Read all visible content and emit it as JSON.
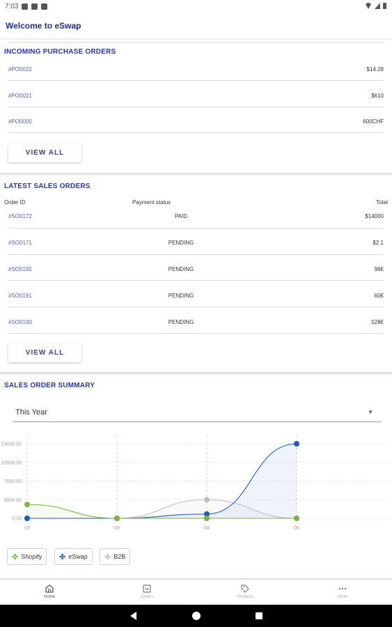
{
  "status_bar": {
    "time": "7:03"
  },
  "app": {
    "title": "Welcome to eSwap"
  },
  "incoming_purchase_orders": {
    "title": "INCOMING PURCHASE ORDERS",
    "rows": [
      {
        "id": "#PO0022",
        "amount": "$14.28"
      },
      {
        "id": "#PO0021",
        "amount": "$610"
      },
      {
        "id": "#PO0005",
        "amount": "600CHF"
      }
    ],
    "view_all": "VIEW ALL"
  },
  "latest_sales_orders": {
    "title": "LATEST SALES ORDERS",
    "columns": {
      "order_id": "Order ID",
      "payment_status": "Payment status",
      "total": "Total"
    },
    "rows": [
      {
        "id": "#SO0172",
        "status": "PAID",
        "total": "$14000"
      },
      {
        "id": "#SO0171",
        "status": "PENDING",
        "total": "$2.1"
      },
      {
        "id": "#SO0192",
        "status": "PENDING",
        "total": "96€"
      },
      {
        "id": "#SO0191",
        "status": "PENDING",
        "total": "60€"
      },
      {
        "id": "#SO0190",
        "status": "PENDING",
        "total": "528€"
      }
    ],
    "view_all": "VIEW ALL"
  },
  "sales_order_summary": {
    "title": "SALES ORDER SUMMARY",
    "period": {
      "selected": "This Year"
    }
  },
  "chart_data": {
    "type": "line",
    "title": "",
    "xlabel": "",
    "ylabel": "",
    "x": [
      "02",
      "03",
      "04",
      "05"
    ],
    "y_ticks": [
      "0.00",
      "3500.00",
      "7000.00",
      "10500.00",
      "14000.00"
    ],
    "ylim": [
      0,
      14000
    ],
    "grid": true,
    "series": [
      {
        "name": "Shopify",
        "color": "#7cb342",
        "values": [
          2600,
          0,
          0,
          0
        ]
      },
      {
        "name": "eSwap",
        "color": "#1e5bbf",
        "values": [
          0,
          0,
          800,
          14000
        ]
      },
      {
        "name": "B2B",
        "color": "#bdbdbd",
        "values": [
          0,
          0,
          3500,
          0
        ]
      }
    ]
  },
  "legend": {
    "items": [
      {
        "label": "Shopify",
        "color": "#7cb342",
        "icon": "shopify-leaf-icon"
      },
      {
        "label": "eSwap",
        "color": "#1e5bbf",
        "icon": "eswap-logo-icon"
      },
      {
        "label": "B2B",
        "color": "#bdbdbd",
        "icon": "b2b-logo-icon"
      }
    ]
  },
  "bottom_nav": {
    "items": [
      {
        "label": "Home",
        "icon": "home-icon",
        "active": true
      },
      {
        "label": "Orders",
        "icon": "orders-icon",
        "active": false
      },
      {
        "label": "Products",
        "icon": "tag-icon",
        "active": false
      },
      {
        "label": "More",
        "icon": "more-icon",
        "active": false
      }
    ]
  }
}
